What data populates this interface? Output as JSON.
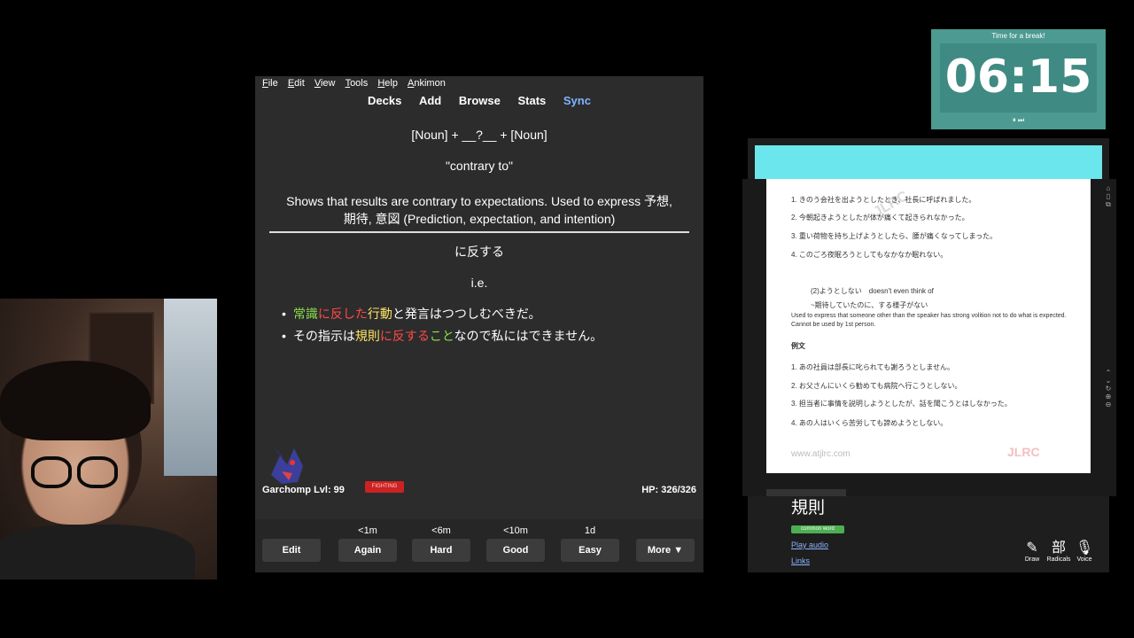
{
  "menu": [
    "File",
    "Edit",
    "View",
    "Tools",
    "Help",
    "Ankimon"
  ],
  "toolbar": {
    "decks": "Decks",
    "add": "Add",
    "browse": "Browse",
    "stats": "Stats",
    "sync": "Sync"
  },
  "card": {
    "pattern": "[Noun] + __?__ + [Noun]",
    "meaning": "\"contrary to\"",
    "explanation_1": "Shows that results are contrary to expectations. Used to express 予想,",
    "explanation_2": "期待, 意図 (Prediction, expectation, and intention)",
    "answer": "に反する",
    "ie": "i.e.",
    "ex1": [
      "常識",
      "に反した",
      "行動",
      "と発言はつつしむべきだ。"
    ],
    "ex2": [
      "その指示は",
      "規則",
      "に反する",
      "こと",
      "なので私にはできません。"
    ]
  },
  "pokemon": {
    "name": "Garchomp Lvl: 99",
    "type": "FIGHTING",
    "hp": "HP: 326/326"
  },
  "answer_buttons": [
    {
      "label": "Edit",
      "due": ""
    },
    {
      "label": "Again",
      "due": "<1m"
    },
    {
      "label": "Hard",
      "due": "<6m"
    },
    {
      "label": "Good",
      "due": "<10m"
    },
    {
      "label": "Easy",
      "due": "1d"
    },
    {
      "label": "More ▼",
      "due": ""
    }
  ],
  "timer": {
    "title": "Time for a break!",
    "time": "06:15",
    "controls": "⏸ ⏭"
  },
  "pdf": {
    "lines1": [
      "1. きのう会社を出ようとしたとき、社長に呼ばれました。",
      "2. 今朝起きようとしたが体が痛くて起きられなかった。",
      "3. 重い荷物を持ち上げようとしたら、腰が痛くなってしまった。",
      "4. このごろ夜眠ろうとしてもなかなか眠れない。"
    ],
    "heading2": "(2)ようとしない　doesn't even think of",
    "sub2": "~期待していたのに、する様子がない",
    "note1": "Used to express that someone other than the speaker has strong volition not to do what is expected.",
    "note2": "Cannot be used by 1st person.",
    "reibun": "例文",
    "lines2": [
      "1. あの社員は部長に叱られても謝ろうとしません。",
      "2. お父さんにいくら勧めても病院へ行こうとしない。",
      "3. 担当者に事情を説明しようとしたが、話を聞こうとはしなかった。",
      "4. あの人はいくら苦労しても諦めようとしない。"
    ],
    "footer": "www.atjlrc.com",
    "footer_logo": "JLRC",
    "watermark": "JLRC"
  },
  "dict": {
    "word": "規則",
    "badge": "common word",
    "play": "Play audio",
    "links": "Links",
    "tools": [
      {
        "icon": "✎",
        "label": "Draw"
      },
      {
        "icon": "部",
        "label": "Radicals"
      },
      {
        "icon": "🎙",
        "label": "Voice"
      }
    ]
  }
}
